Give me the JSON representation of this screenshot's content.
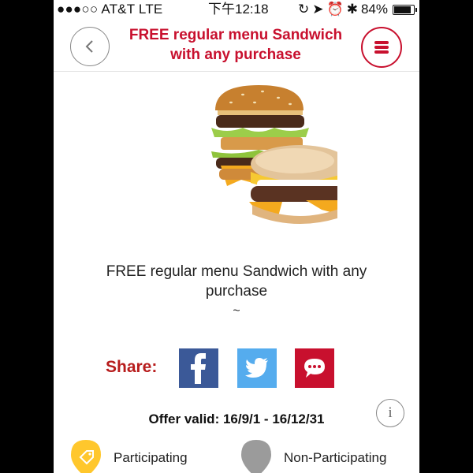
{
  "status_bar": {
    "carrier": "●●●○○ AT&T  LTE",
    "time": "下午12:18",
    "battery": "84%"
  },
  "header": {
    "title": "FREE regular menu Sandwich with any purchase",
    "back_icon": "chevron-left-icon",
    "menu_icon": "hamburger-menu-icon"
  },
  "offer": {
    "description": "FREE regular menu Sandwich with any purchase",
    "tilde": "~",
    "valid_text": "Offer valid: 16/9/1 - 16/12/31"
  },
  "share": {
    "label": "Share:",
    "buttons": [
      {
        "name": "facebook",
        "color": "#3b5998"
      },
      {
        "name": "twitter",
        "color": "#55acee"
      },
      {
        "name": "message",
        "color": "#c8102e"
      }
    ]
  },
  "legend": {
    "participating": "Participating",
    "non_participating": "Non-Participating",
    "participating_color": "#ffc72c",
    "non_participating_color": "#9b9b9b"
  },
  "colors": {
    "brand_red": "#c8102e"
  }
}
